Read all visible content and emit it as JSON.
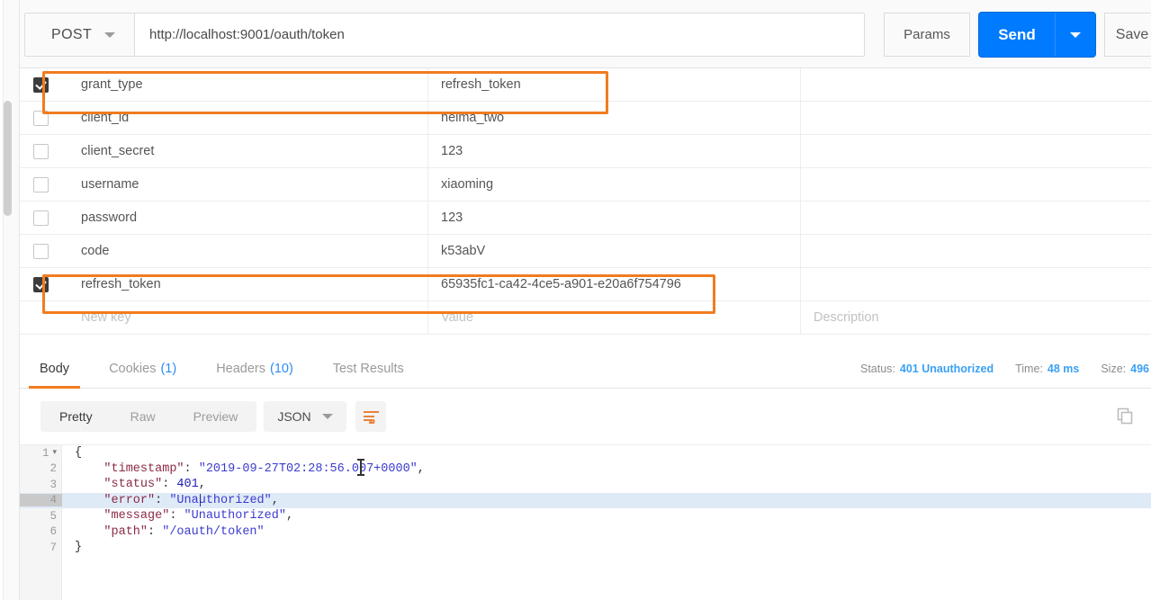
{
  "request": {
    "method": "POST",
    "url": "http://localhost:9001/oauth/token",
    "params_label": "Params",
    "send_label": "Send",
    "save_label": "Save"
  },
  "params_table": {
    "headers": {
      "key": "New key",
      "value": "Value",
      "description": "Description"
    },
    "rows": [
      {
        "checked": true,
        "key": "grant_type",
        "value": "refresh_token",
        "description": ""
      },
      {
        "checked": false,
        "key": "client_id",
        "value": "heima_two",
        "description": ""
      },
      {
        "checked": false,
        "key": "client_secret",
        "value": "123",
        "description": ""
      },
      {
        "checked": false,
        "key": "username",
        "value": "xiaoming",
        "description": ""
      },
      {
        "checked": false,
        "key": "password",
        "value": "123",
        "description": ""
      },
      {
        "checked": false,
        "key": "code",
        "value": "k53abV",
        "description": ""
      },
      {
        "checked": true,
        "key": "refresh_token",
        "value": "65935fc1-ca42-4ce5-a901-e20a6f754796",
        "description": ""
      }
    ]
  },
  "highlights": {
    "color": "#f07c1f"
  },
  "response": {
    "tabs": [
      {
        "label": "Body",
        "count": "",
        "active": true
      },
      {
        "label": "Cookies",
        "count": "(1)",
        "active": false
      },
      {
        "label": "Headers",
        "count": "(10)",
        "active": false
      },
      {
        "label": "Test Results",
        "count": "",
        "active": false
      }
    ],
    "status": {
      "label": "Status:",
      "value": "401 Unauthorized"
    },
    "time": {
      "label": "Time:",
      "value": "48 ms"
    },
    "size": {
      "label": "Size:",
      "value": "496"
    },
    "view_modes": [
      {
        "label": "Pretty",
        "active": true
      },
      {
        "label": "Raw",
        "active": false
      },
      {
        "label": "Preview",
        "active": false
      }
    ],
    "format": "JSON",
    "icons": {
      "wrap": "wrap-lines-icon",
      "copy": "copy-icon",
      "search": "search-icon"
    },
    "body_lines": [
      {
        "num": "1",
        "fold": "▾",
        "highlighted": false,
        "segments": [
          {
            "t": "p",
            "v": "{"
          }
        ]
      },
      {
        "num": "2",
        "fold": "",
        "highlighted": false,
        "segments": [
          {
            "t": "p",
            "v": "    "
          },
          {
            "t": "k",
            "v": "\"timestamp\""
          },
          {
            "t": "p",
            "v": ": "
          },
          {
            "t": "s",
            "v": "\"2019-09-27T02:28:56.007+0000\""
          },
          {
            "t": "p",
            "v": ","
          }
        ]
      },
      {
        "num": "3",
        "fold": "",
        "highlighted": false,
        "segments": [
          {
            "t": "p",
            "v": "    "
          },
          {
            "t": "k",
            "v": "\"status\""
          },
          {
            "t": "p",
            "v": ": "
          },
          {
            "t": "n",
            "v": "401"
          },
          {
            "t": "p",
            "v": ","
          }
        ]
      },
      {
        "num": "4",
        "fold": "",
        "highlighted": true,
        "segments": [
          {
            "t": "p",
            "v": "    "
          },
          {
            "t": "k",
            "v": "\"error\""
          },
          {
            "t": "p",
            "v": ": "
          },
          {
            "t": "s",
            "v": "\"Unauthorized\""
          },
          {
            "t": "p",
            "v": ","
          }
        ]
      },
      {
        "num": "5",
        "fold": "",
        "highlighted": false,
        "segments": [
          {
            "t": "p",
            "v": "    "
          },
          {
            "t": "k",
            "v": "\"message\""
          },
          {
            "t": "p",
            "v": ": "
          },
          {
            "t": "s",
            "v": "\"Unauthorized\""
          },
          {
            "t": "p",
            "v": ","
          }
        ]
      },
      {
        "num": "6",
        "fold": "",
        "highlighted": false,
        "segments": [
          {
            "t": "p",
            "v": "    "
          },
          {
            "t": "k",
            "v": "\"path\""
          },
          {
            "t": "p",
            "v": ": "
          },
          {
            "t": "s",
            "v": "\"/oauth/token\""
          }
        ]
      },
      {
        "num": "7",
        "fold": "",
        "highlighted": false,
        "segments": [
          {
            "t": "p",
            "v": "}"
          }
        ]
      }
    ]
  }
}
